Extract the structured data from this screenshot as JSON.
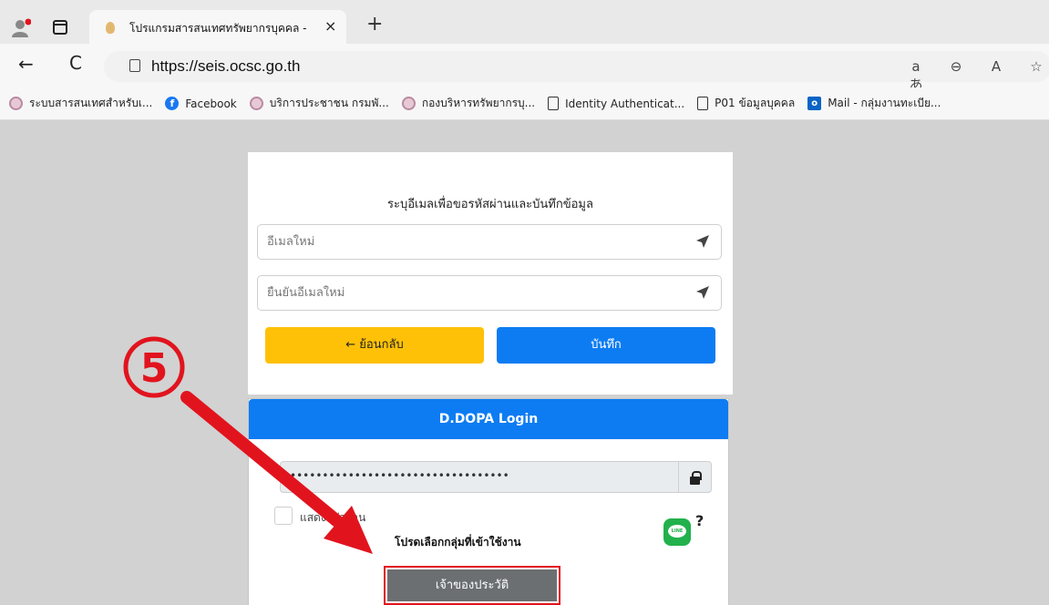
{
  "tab": {
    "title": "โปรแกรมสารสนเทศทรัพยากรบุคคล -",
    "close": "×",
    "new_tab": "+"
  },
  "address": {
    "url": "https://seis.ocsc.go.th",
    "back": "←",
    "reload": "C",
    "icons": [
      "aあ",
      "⊖",
      "A",
      "☆"
    ]
  },
  "bookmarks": [
    {
      "label": "ระบบสารสนเทศสำหรับเ...",
      "icon": "seal-icon"
    },
    {
      "label": "Facebook",
      "icon": "facebook-icon"
    },
    {
      "label": "บริการประชาชน กรมพั...",
      "icon": "seal-icon"
    },
    {
      "label": "กองบริหารทรัพยากรบุ...",
      "icon": "seal-icon"
    },
    {
      "label": "Identity Authenticat...",
      "icon": "page-icon"
    },
    {
      "label": "P01 ข้อมูลบุคคล",
      "icon": "page-icon"
    },
    {
      "label": "Mail - กลุ่มงานทะเบีย...",
      "icon": "outlook-icon"
    }
  ],
  "email_form": {
    "title": "ระบุอีเมลเพื่อขอรหัสผ่านและบันทึกข้อมูล",
    "new_email_placeholder": "อีเมลใหม่",
    "confirm_email_placeholder": "ยืนยันอีเมลใหม่",
    "back_label": "←  ย้อนกลับ",
    "save_label": "บันทึก"
  },
  "login": {
    "header": "D.DOPA Login",
    "password_mask": "••••••••••••••••••••••••••••••••••",
    "show_password_label": "แสดงรหัสผ่าน",
    "group_prompt": "โปรดเลือกกลุ่มที่เข้าใช้งาน",
    "line_help": "?",
    "owner_button": "เจ้าของประวัติ"
  },
  "annotation": {
    "step_number": "5",
    "color": "#e1141e"
  },
  "colors": {
    "yellow": "#ffc107",
    "blue": "#0d7cf2",
    "gray_button": "#6c6f72",
    "line_green": "#22b14c"
  }
}
